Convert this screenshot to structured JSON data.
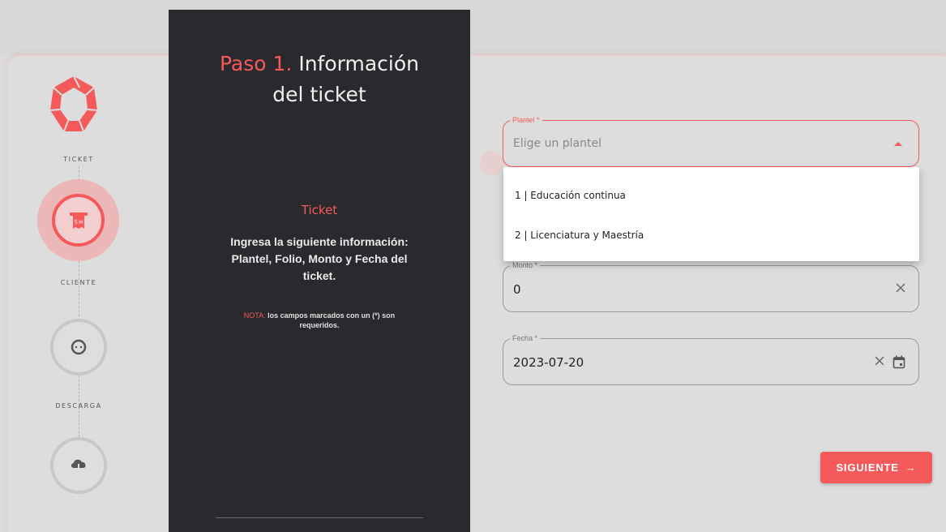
{
  "steps": [
    {
      "label": "TICKET"
    },
    {
      "label": "CLIENTE"
    },
    {
      "label": "DESCARGA"
    }
  ],
  "panel": {
    "title_step": "Paso 1.",
    "title_rest_line1": " Información",
    "title_line2": "del ticket",
    "subtitle": "Ticket",
    "description": "Ingresa la siguiente información: Plantel, Folio, Monto y Fecha del ticket.",
    "note_prefix": "NOTA:",
    "note_text": " los campos marcados con un (*) son requeridos."
  },
  "form": {
    "plantel": {
      "label": "Plantel *",
      "placeholder": "Elige un plantel"
    },
    "monto": {
      "label": "Monto *",
      "value": "0"
    },
    "fecha": {
      "label": "Fecha *",
      "value": "2023-07-20"
    }
  },
  "dropdown": {
    "options": [
      "1 | Educación continua",
      "2 | Licenciatura y Maestría"
    ]
  },
  "next_button": {
    "label": "SIGUIENTE",
    "arrow": "→"
  },
  "colors": {
    "accent": "#f55a5a",
    "panel": "#2a2a2e",
    "background": "#dddddd"
  },
  "icons": {
    "logo": "knot-logo-icon",
    "step1": "ticket-receipt-icon",
    "step2": "chat-bubble-icon",
    "step3": "cloud-download-icon",
    "clear": "close-icon",
    "calendar": "calendar-icon"
  }
}
